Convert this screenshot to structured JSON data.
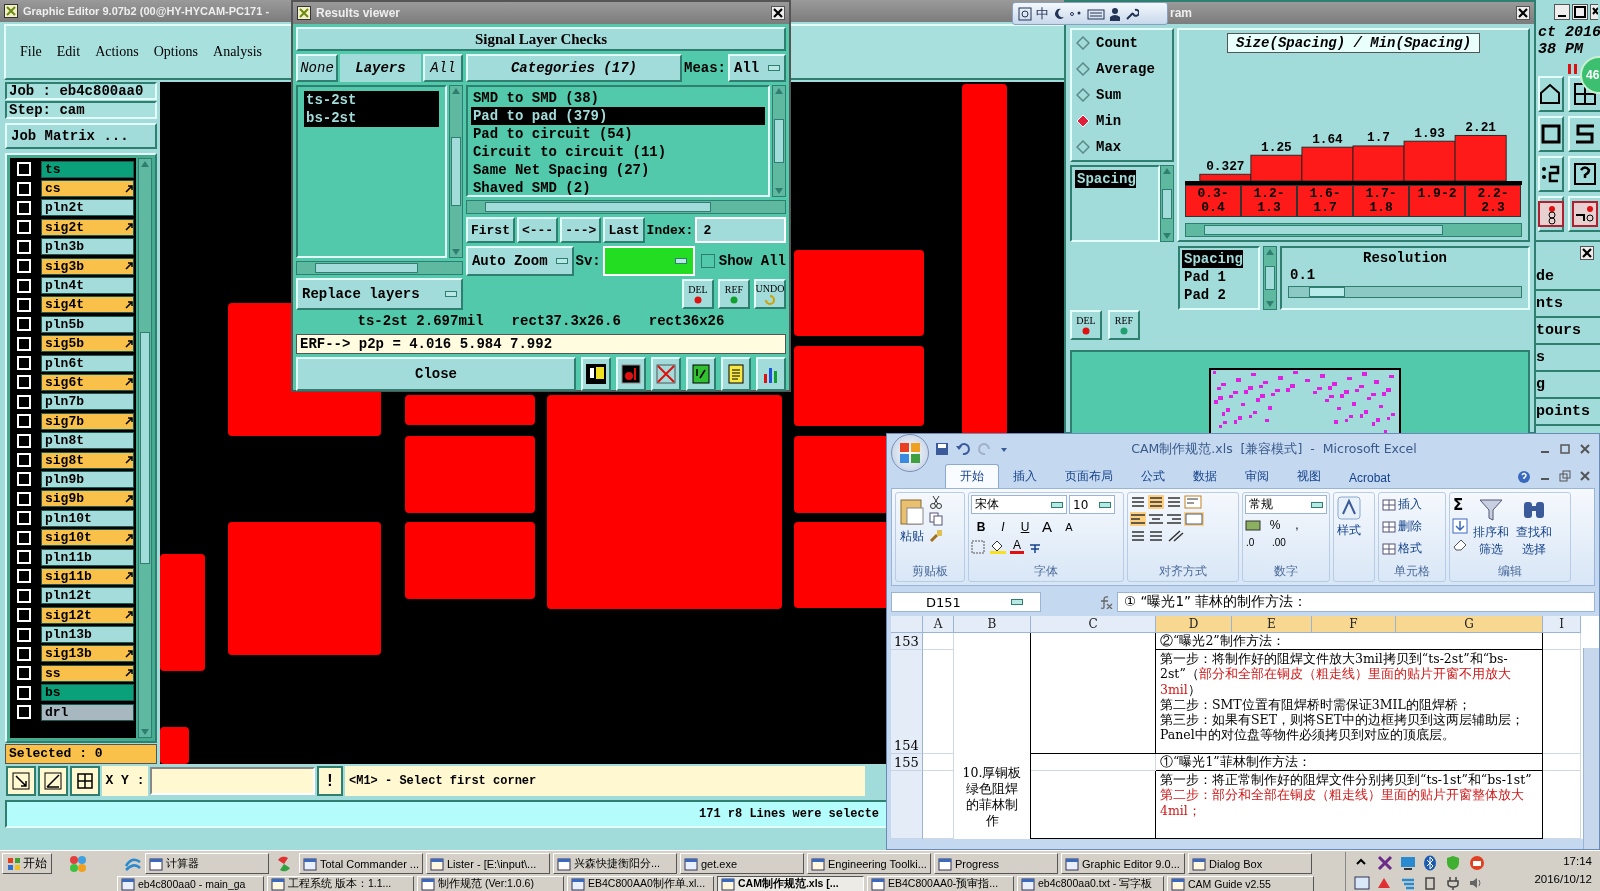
{
  "editor": {
    "title": "Graphic Editor 9.07b2 (00@HY-HYCAM-PC171 -",
    "menu": [
      "File",
      "Edit",
      "Actions",
      "Options",
      "Analysis"
    ],
    "job": "Job : eb4c800aa0",
    "step": "Step: cam",
    "job_matrix": "Job Matrix ...",
    "layers": [
      {
        "name": "ts",
        "kind": "mask",
        "color": "#0aa07a",
        "checked": false
      },
      {
        "name": "cs",
        "kind": "signal",
        "color": "#f9c04a",
        "checked": false
      },
      {
        "name": "pln2t",
        "kind": "plane",
        "color": "#a4dcdc",
        "checked": false
      },
      {
        "name": "sig2t",
        "kind": "signal",
        "color": "#f9c04a",
        "checked": false
      },
      {
        "name": "pln3b",
        "kind": "plane",
        "color": "#a4dcdc",
        "checked": false
      },
      {
        "name": "sig3b",
        "kind": "signal",
        "color": "#f9c04a",
        "checked": false
      },
      {
        "name": "pln4t",
        "kind": "plane",
        "color": "#a4dcdc",
        "checked": false
      },
      {
        "name": "sig4t",
        "kind": "signal",
        "color": "#f9c04a",
        "checked": false
      },
      {
        "name": "pln5b",
        "kind": "plane",
        "color": "#a4dcdc",
        "checked": false
      },
      {
        "name": "sig5b",
        "kind": "signal",
        "color": "#f9c04a",
        "checked": false
      },
      {
        "name": "pln6t",
        "kind": "plane",
        "color": "#a4dcdc",
        "checked": false
      },
      {
        "name": "sig6t",
        "kind": "signal",
        "color": "#f9c04a",
        "checked": false
      },
      {
        "name": "pln7b",
        "kind": "plane",
        "color": "#a4dcdc",
        "checked": false
      },
      {
        "name": "sig7b",
        "kind": "signal",
        "color": "#f9c04a",
        "checked": false
      },
      {
        "name": "pln8t",
        "kind": "plane",
        "color": "#a4dcdc",
        "checked": false
      },
      {
        "name": "sig8t",
        "kind": "signal",
        "color": "#f9c04a",
        "checked": false
      },
      {
        "name": "pln9b",
        "kind": "plane",
        "color": "#a4dcdc",
        "checked": false
      },
      {
        "name": "sig9b",
        "kind": "signal",
        "color": "#f9c04a",
        "checked": false
      },
      {
        "name": "pln10t",
        "kind": "plane",
        "color": "#a4dcdc",
        "checked": false
      },
      {
        "name": "sig10t",
        "kind": "signal",
        "color": "#f9c04a",
        "checked": false
      },
      {
        "name": "pln11b",
        "kind": "plane",
        "color": "#a4dcdc",
        "checked": false
      },
      {
        "name": "sig11b",
        "kind": "signal",
        "color": "#f9c04a",
        "checked": false
      },
      {
        "name": "pln12t",
        "kind": "plane",
        "color": "#a4dcdc",
        "checked": false
      },
      {
        "name": "sig12t",
        "kind": "signal",
        "color": "#f9c04a",
        "checked": false
      },
      {
        "name": "pln13b",
        "kind": "plane",
        "color": "#a4dcdc",
        "checked": false
      },
      {
        "name": "sig13b",
        "kind": "signal",
        "color": "#f9c04a",
        "checked": false
      },
      {
        "name": "ss",
        "kind": "signal",
        "color": "#f9c04a",
        "checked": false
      },
      {
        "name": "bs",
        "kind": "mask",
        "color": "#0aa07a",
        "checked": false
      },
      {
        "name": "drl",
        "kind": "drill",
        "color": "#a8b8c0",
        "checked": false
      }
    ],
    "selected_count": "Selected : 0",
    "coord_label": "X Y :",
    "alert": "!",
    "prompt": "<M1> - Select first corner",
    "status": "171 r8 Lines were selecte"
  },
  "results_viewer": {
    "title": "Results viewer",
    "heading": "Signal Layer Checks",
    "none": "None",
    "layers_header": "Layers",
    "all": "All",
    "layers": [
      {
        "label": "ts-2st",
        "selected": true
      },
      {
        "label": "bs-2st",
        "selected": true
      }
    ],
    "categories_header": "Categories (17)",
    "meas_label": "Meas:",
    "meas_value": "All",
    "categories": [
      {
        "label": "SMD to SMD (38)",
        "selected": false
      },
      {
        "label": "Pad to pad (379)",
        "selected": true
      },
      {
        "label": "Pad to circuit (54)",
        "selected": false
      },
      {
        "label": "Circuit to circuit (11)",
        "selected": false
      },
      {
        "label": "Same Net Spacing (27)",
        "selected": false
      },
      {
        "label": "Shaved SMD (2)",
        "selected": false
      }
    ],
    "nav": [
      "First",
      "<---",
      "--->",
      "Last"
    ],
    "index_label": "Index:",
    "index_value": "2",
    "auto_zoom": "Auto Zoom",
    "sv_label": "Sv:",
    "show_all": {
      "label": "Show All",
      "checked": false
    },
    "replace": "Replace layers",
    "actions": [
      "DEL",
      "REF",
      "UNDO"
    ],
    "info": [
      "ts-2st 2.697mil",
      "rect37.3x26.6",
      "rect36x26"
    ],
    "erf": "ERF--> p2p = 4.016 5.984 7.992",
    "close": "Close"
  },
  "ime_bar": {
    "label": "中"
  },
  "analysis_window": {
    "title": "ram",
    "functions": [
      {
        "label": "Count",
        "selected": false
      },
      {
        "label": "Average",
        "selected": false
      },
      {
        "label": "Sum",
        "selected": false
      },
      {
        "label": "Min",
        "selected": true
      },
      {
        "label": "Max",
        "selected": false
      }
    ],
    "measures": [
      {
        "label": "Spacing",
        "selected": true
      }
    ],
    "del": "DEL",
    "ref": "REF",
    "chart_data": {
      "type": "bar",
      "title": "Size(Spacing) / Min(Spacing)",
      "categories": [
        "0.3-0.4",
        "1.2-1.3",
        "1.6-1.7",
        "1.7-1.8",
        "1.9-2",
        "2.2-2.3"
      ],
      "series": [
        {
          "color": "#ff1a1a",
          "values": [
            0.327,
            1.25,
            1.64,
            1.7,
            1.93,
            2.21
          ]
        }
      ],
      "data_labels": true
    },
    "columns": [
      {
        "label": "Spacing",
        "selected": true
      },
      {
        "label": "Pad 1",
        "selected": false
      },
      {
        "label": "Pad 2",
        "selected": false
      }
    ],
    "resolution": {
      "title": "Resolution",
      "value": "0.1",
      "level": 0.1
    }
  },
  "side_window": {
    "clock": [
      "ct 2016",
      "38 PM"
    ],
    "badge": "46",
    "items": [
      "de",
      "nts",
      "tours",
      "s",
      "g",
      "points"
    ]
  },
  "excel": {
    "title": "CAM制作规范.xls  [兼容模式]  -  Microsoft Excel",
    "tabs": [
      {
        "label": "开始",
        "selected": true
      },
      {
        "label": "插入",
        "selected": false
      },
      {
        "label": "页面布局",
        "selected": false
      },
      {
        "label": "公式",
        "selected": false
      },
      {
        "label": "数据",
        "selected": false
      },
      {
        "label": "审阅",
        "selected": false
      },
      {
        "label": "视图",
        "selected": false
      },
      {
        "label": "Acrobat",
        "selected": false
      }
    ],
    "paste": "粘贴",
    "font_name": "宋体",
    "font_size": "10",
    "font_styles": [
      "B",
      "I",
      "U"
    ],
    "font_sizes": [
      "A",
      "A"
    ],
    "font_color": "A",
    "number_format": "常规",
    "number_symbols": [
      "%",
      ","
    ],
    "decimals": [
      ".0",
      ".00"
    ],
    "style": "样式",
    "cell_actions": [
      "插入",
      "删除",
      "格式"
    ],
    "sum": "Σ",
    "sort": "排序和筛选",
    "find": "查找和选择",
    "groups": [
      "剪贴板",
      "字体",
      "对齐方式",
      "数字",
      "单元格",
      "编辑"
    ],
    "name_box": "D151",
    "formula": "① “曝光1” 菲林的制作方法：",
    "columns": [
      "A",
      "B",
      "C",
      "D",
      "E",
      "F",
      "G",
      "I"
    ],
    "rows": [
      {
        "number": "153",
        "lines": [
          [
            {
              "text": "②“曝光2”制作方法："
            }
          ]
        ]
      },
      {
        "number": "154",
        "lines": [
          [
            {
              "text": "第一步：将制作好的阻焊文件放大3mil拷贝到“ts-2st”和“bs-2st”（"
            },
            {
              "text": "部分和全部在铜皮（粗走线）里面的贴片开窗不用放大3mil",
              "red": true
            },
            {
              "text": "）"
            }
          ],
          [
            {
              "text": "第二步：SMT位置有阻焊桥时需保证3MIL的阻焊桥；"
            }
          ],
          [
            {
              "text": "第三步：如果有SET，则将SET中的边框拷贝到这两层辅助层；"
            }
          ],
          [
            {
              "text": "Panel中的对位盘等物件必须拷贝到对应的顶底层。"
            }
          ]
        ]
      },
      {
        "number": "155",
        "lines": [
          [
            {
              "text": "①“曝光1”菲林制作方法："
            }
          ]
        ]
      },
      {
        "lines": [
          [
            {
              "text": "第一步：将正常制作好的阻焊文件分别拷贝到“ts-1st”和“bs-1st”"
            }
          ],
          [
            {
              "text": "第二步：部分和全部在铜皮（粗走线）里面的贴片开窗整体放大4mil；",
              "red": true
            }
          ]
        ]
      }
    ],
    "merged_label": "10.厚铜板绿色阻焊的菲林制作"
  },
  "taskbar": {
    "start": "开始",
    "row1": [
      {
        "label": "计算器",
        "selected": false
      },
      {
        "label": "Total Commander ...",
        "selected": false
      },
      {
        "label": "Lister - [E:\\input\\...",
        "selected": false
      },
      {
        "label": "兴森快捷衡阳分...",
        "selected": false
      },
      {
        "label": "get.exe",
        "selected": false
      },
      {
        "label": "Engineering Toolki...",
        "selected": false
      },
      {
        "label": "Progress",
        "selected": false
      },
      {
        "label": "Graphic Editor 9.0...",
        "selected": false
      },
      {
        "label": "Dialog Box",
        "selected": false
      }
    ],
    "row2": [
      {
        "label": "eb4c800aa0 - main_ga",
        "selected": false
      },
      {
        "label": "工程系统  版本：1.1...",
        "selected": false
      },
      {
        "label": "制作规范 (Ver:1.0.6)",
        "selected": false
      },
      {
        "label": "EB4C800AA0制作单.xl...",
        "selected": false
      },
      {
        "label": "CAM制作规范.xls [...",
        "selected": true
      },
      {
        "label": "EB4C800AA0-预审指...",
        "selected": false
      },
      {
        "label": "eb4c800aa0.txt - 写字板",
        "selected": false
      },
      {
        "label": "CAM  Guide v2.55",
        "selected": false
      }
    ],
    "time": "17:14",
    "date": "2016/10/12"
  }
}
